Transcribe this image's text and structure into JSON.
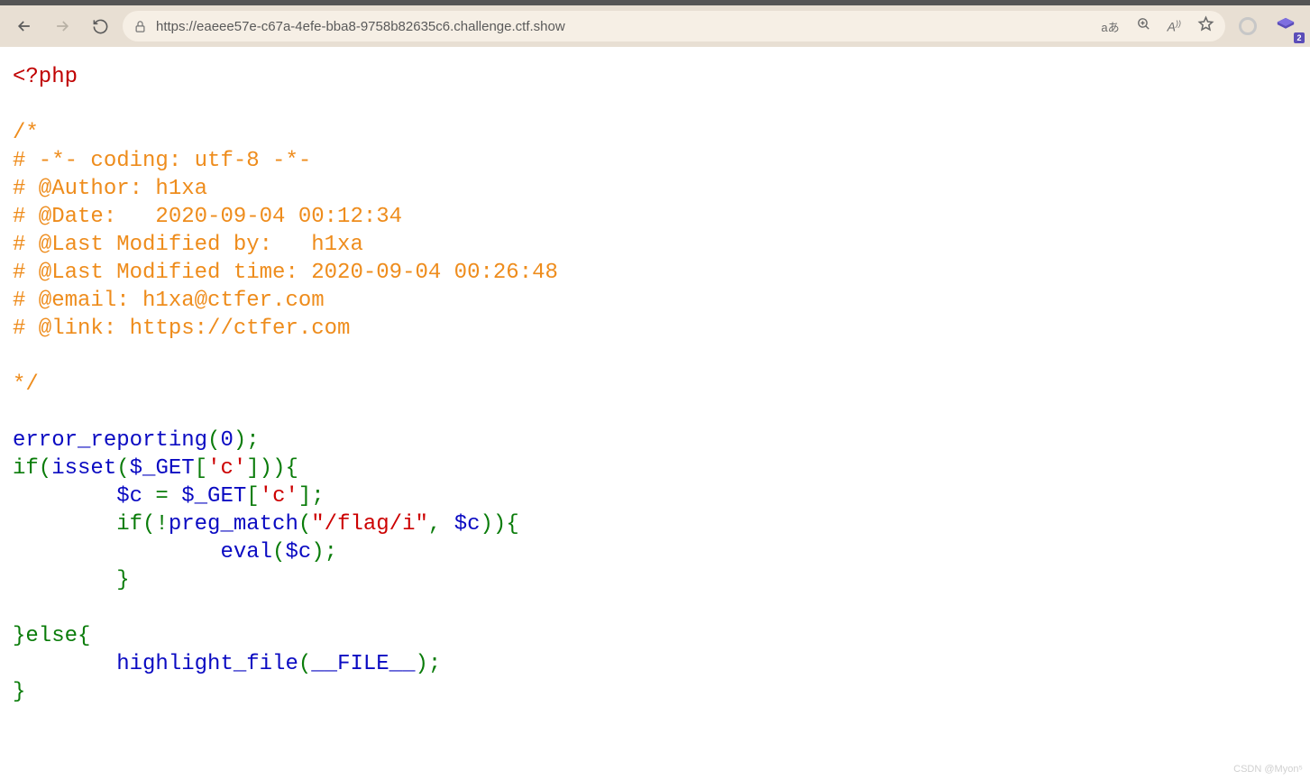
{
  "browser": {
    "url": "https://eaeee57e-c67a-4efe-bba8-9758b82635c6.challenge.ctf.show",
    "translate_label": "aあ",
    "ext_badge": "2"
  },
  "code": {
    "php_open": "<?php",
    "comment_open": "/*",
    "cm1": "# -*- coding: utf-8 -*-",
    "cm2": "# @Author: h1xa",
    "cm3": "# @Date:   2020-09-04 00:12:34",
    "cm4": "# @Last Modified by:   h1xa",
    "cm5": "# @Last Modified time: 2020-09-04 00:26:48",
    "cm6": "# @email: h1xa@ctfer.com",
    "cm7": "# @link: https://ctfer.com",
    "comment_close": "*/",
    "fn_error_reporting": "error_reporting",
    "paren_open": "(",
    "zero": "0",
    "paren_close_semi": ");",
    "if": "if(",
    "isset": "isset",
    "get_open": "(",
    "dollar_get": "$_GET",
    "bracket_open": "[",
    "c_key": "'c'",
    "bracket_close": "]))",
    "brace_open": "{",
    "indent1": "        ",
    "dollar_c": "$c",
    "eq": " = ",
    "dollar_get2": "$_GET",
    "bracket_open2": "[",
    "c_key2": "'c'",
    "bracket_close2": "];",
    "indent2": "        if(!",
    "preg_match": "preg_match",
    "pm_open": "(",
    "pattern": "\"/flag/i\"",
    "comma": ", ",
    "dollar_c2": "$c",
    "pm_close": ")){",
    "indent3": "                ",
    "eval": "eval",
    "eval_open": "(",
    "dollar_c3": "$c",
    "eval_close": ");",
    "indent4": "        }",
    "else_line": "}else{",
    "indent5": "        ",
    "highlight_file": "highlight_file",
    "hl_open": "(",
    "file_const": "__FILE__",
    "hl_close": ");",
    "final_brace": "}"
  },
  "watermark": "CSDN @Myon⁵"
}
